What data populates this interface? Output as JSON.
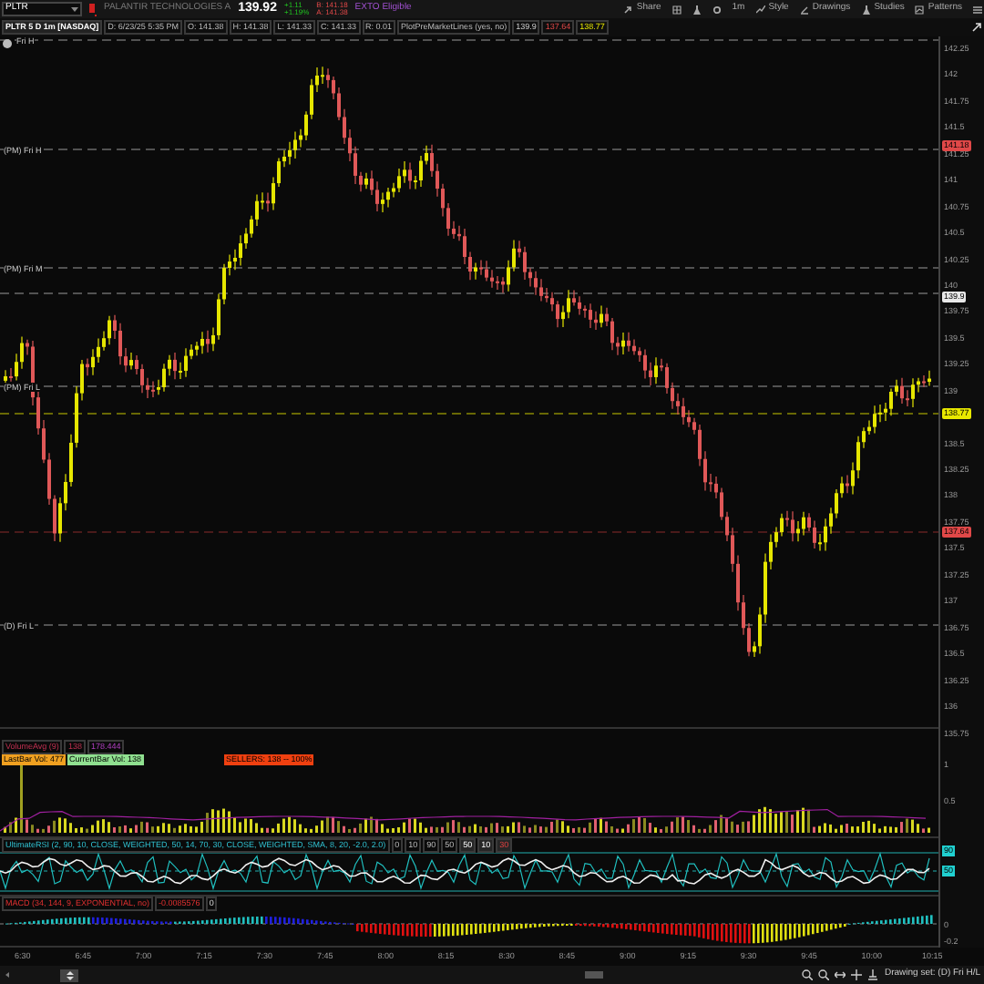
{
  "symbol_bar": {
    "symbol": "PLTR",
    "company": "PALANTIR TECHNOLOGIES A",
    "last": "139.92",
    "change": "+1.11",
    "change_pct": "+1.19%",
    "bid": "B: 141.18",
    "ask": "A: 141.38",
    "badge": "EXTO Eligible"
  },
  "toolbar": [
    {
      "kind": "share",
      "label": "Share"
    },
    {
      "kind": "grid"
    },
    {
      "kind": "flask"
    },
    {
      "kind": "gear"
    },
    {
      "kind": "text",
      "label": "1m"
    },
    {
      "kind": "style",
      "label": "Style"
    },
    {
      "kind": "drawings",
      "label": "Drawings"
    },
    {
      "kind": "studies",
      "label": "Studies"
    },
    {
      "kind": "patterns",
      "label": "Patterns"
    },
    {
      "kind": "menu"
    }
  ],
  "info_bar": [
    "PLTR 5 D 1m [NASDAQ]",
    "D: 6/23/25 5:35 PM",
    "O: 141.38",
    "H: 141.38",
    "L: 141.33",
    "C: 141.33",
    "R: 0.01",
    "PlotPreMarketLines (yes, no)"
  ],
  "study_values": [
    {
      "text": "139.9",
      "kind": "mid"
    },
    {
      "text": "137.64",
      "kind": "low"
    },
    {
      "text": "138.77",
      "kind": "last"
    }
  ],
  "levels": [
    {
      "label": "Fri H"
    },
    {
      "label": "(PM) Fri H"
    },
    {
      "label": "(PM) Fri M"
    },
    {
      "label": "(PM) Fri L"
    },
    {
      "label": "(D) Fri L"
    }
  ],
  "price_axis": [
    "142.25",
    "142",
    "141.75",
    "141.5",
    "141.25",
    "141",
    "140.75",
    "140.5",
    "140.25",
    "140",
    "139.75",
    "139.5",
    "139.25",
    "139",
    "138.5",
    "138.25",
    "138",
    "137.75",
    "137.5",
    "137.25",
    "137",
    "136.75",
    "136.5",
    "136.25",
    "136"
  ],
  "axis_badges": [
    {
      "text": "141.18",
      "color": "#e04848"
    },
    {
      "text": "139.9",
      "color": "#e8e8e8"
    },
    {
      "text": "138.77",
      "color": "#e8e800"
    },
    {
      "text": "137.64",
      "color": "#e04848"
    }
  ],
  "volume": {
    "title": "VolumeAvg (9)",
    "values": [
      "138",
      "178.444"
    ],
    "last_bar": "LastBar Vol: 477",
    "current_bar": "CurrentBar Vol: 138",
    "sellers": "SELLERS: 138 -- 100%",
    "axis": [
      "135.75",
      "1",
      "0.5"
    ]
  },
  "rsi": {
    "title": "UltimateRSI (2, 90, 10, CLOSE, WEIGHTED, 50, 14, 70, 30, CLOSE, WEIGHTED, SMA, 8, 20, -2.0, 2.0)",
    "chips": [
      {
        "text": "0",
        "kind": "input"
      },
      {
        "text": "10",
        "kind": "input"
      },
      {
        "text": "90",
        "kind": "input"
      },
      {
        "text": "50",
        "kind": "input"
      },
      {
        "text": "50",
        "kind": "level"
      },
      {
        "text": "10",
        "kind": "level"
      },
      {
        "text": "30",
        "kind": "alert"
      }
    ],
    "axis_badges": [
      "90",
      "50"
    ]
  },
  "macd": {
    "title": "MACD (34, 144, 9, EXPONENTIAL, no)",
    "value": "-0.0085576",
    "zero": "0",
    "axis": [
      "0",
      "-0.2"
    ]
  },
  "time_axis": [
    "6:30",
    "6:45",
    "7:00",
    "7:15",
    "7:30",
    "7:45",
    "8:00",
    "8:15",
    "8:30",
    "8:45",
    "9:00",
    "9:15",
    "9:30",
    "9:45",
    "10:00",
    "10:15"
  ],
  "status_bar": {
    "drawing_set": "Drawing set: (D) Fri H/L"
  }
}
